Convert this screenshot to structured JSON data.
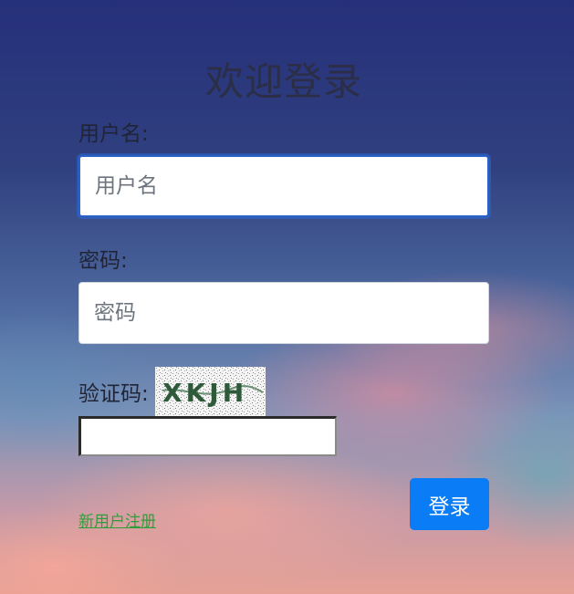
{
  "page": {
    "title": "欢迎登录"
  },
  "form": {
    "username_label": "用户名:",
    "username_placeholder": "用户名",
    "username_value": "",
    "password_label": "密码:",
    "password_placeholder": "密码",
    "password_value": "",
    "captcha_label": "验证码:",
    "captcha_value": "",
    "captcha_text": "XKJH",
    "register_link": "新用户注册",
    "login_button": "登录"
  },
  "colors": {
    "primary_button": "#0a7cf5",
    "link": "#2f9e3a",
    "focus_border": "#2b62c9"
  }
}
